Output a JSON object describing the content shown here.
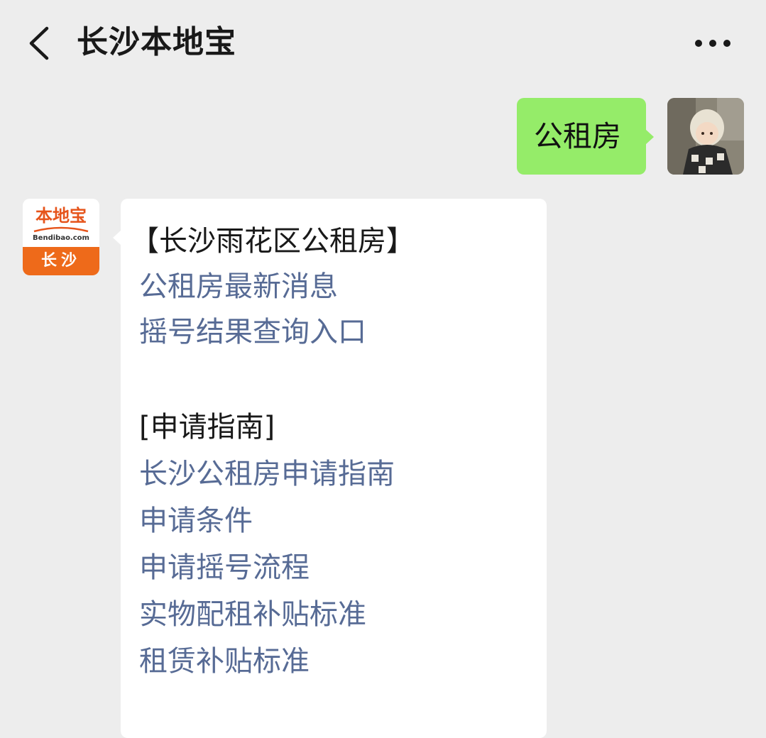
{
  "header": {
    "title": "长沙本地宝",
    "back_icon": "chevron-left-icon",
    "more_icon": "more-dots-icon"
  },
  "sent_message": {
    "text": "公租房",
    "bubble_color": "#95ec69"
  },
  "account_logo": {
    "brand": "本地宝",
    "domain": "Bendibao.com",
    "city": "长沙",
    "accent_color": "#ee6a1a"
  },
  "reply": {
    "heading_1": "【长沙雨花区公租房】",
    "links_1": [
      "公租房最新消息",
      "摇号结果查询入口"
    ],
    "heading_2": "[申请指南]",
    "links_2": [
      "长沙公租房申请指南",
      "申请条件",
      "申请摇号流程",
      "实物配租补贴标准",
      "租赁补贴标准"
    ],
    "link_color": "#576b95"
  }
}
